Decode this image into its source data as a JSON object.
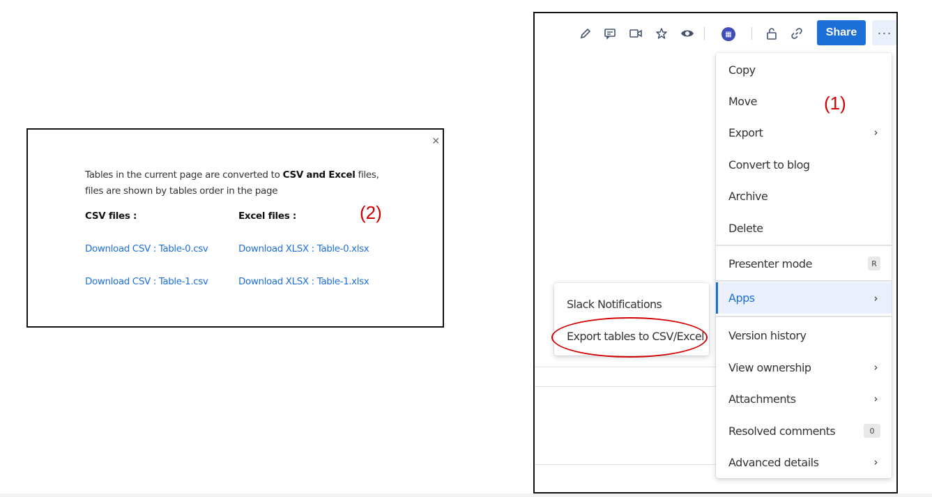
{
  "dialog": {
    "close_glyph": "×",
    "desc_prefix": "Tables in the current page are converted to ",
    "desc_bold": "CSV and Excel",
    "desc_suffix": " files, files are shown by tables order in the page",
    "csv_heading": "CSV files :",
    "excel_heading": "Excel files :",
    "csv_links": [
      "Download CSV : Table-0.csv",
      "Download CSV : Table-1.csv"
    ],
    "excel_links": [
      "Download XLSX : Table-0.xlsx",
      "Download XLSX : Table-1.xlsx"
    ],
    "marker": "(2)"
  },
  "toolbar": {
    "icons": [
      "edit-icon",
      "comment-icon",
      "video-icon",
      "star-icon",
      "watch-icon",
      "avatar",
      "unlock-icon",
      "link-icon"
    ],
    "share_label": "Share",
    "more_glyph": "···"
  },
  "menu": {
    "marker": "(1)",
    "items": [
      {
        "label": "Copy"
      },
      {
        "label": "Move"
      },
      {
        "label": "Export",
        "chevron": "›"
      },
      {
        "label": "Convert to blog"
      },
      {
        "label": "Archive"
      },
      {
        "label": "Delete"
      },
      {
        "label": "Presenter mode",
        "shortcut": "R"
      },
      {
        "label": "Apps",
        "chevron": "›"
      },
      {
        "label": "Version history"
      },
      {
        "label": "View ownership",
        "chevron": "›"
      },
      {
        "label": "Attachments",
        "chevron": "›"
      },
      {
        "label": "Resolved comments",
        "badge": "0"
      },
      {
        "label": "Advanced details",
        "chevron": "›"
      }
    ]
  },
  "apps_submenu": {
    "items": [
      "Slack Notifications",
      "Export tables to CSV/Excel"
    ]
  },
  "colors": {
    "accent": "#1d6fd8",
    "annotation": "#d00000",
    "link": "#1e6fd9"
  }
}
